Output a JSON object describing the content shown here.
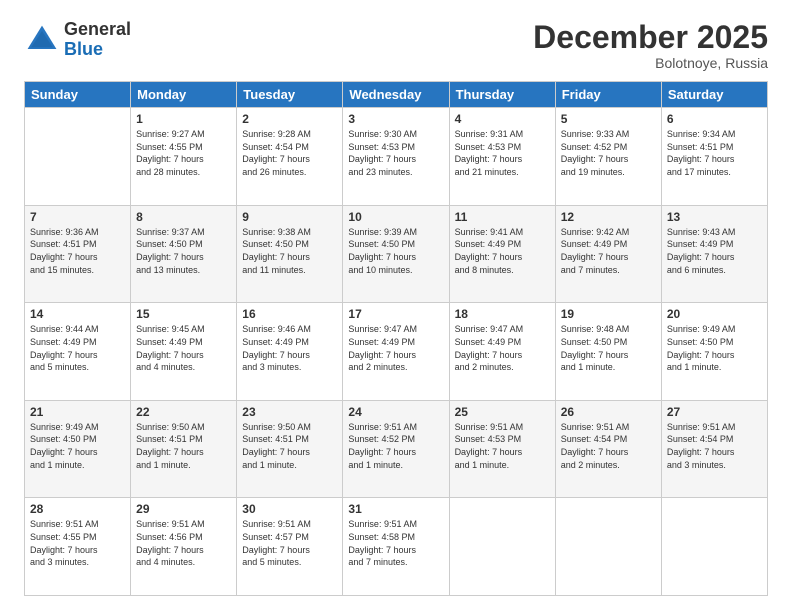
{
  "logo": {
    "general": "General",
    "blue": "Blue"
  },
  "header": {
    "month": "December 2025",
    "location": "Bolotnoye, Russia"
  },
  "days": [
    "Sunday",
    "Monday",
    "Tuesday",
    "Wednesday",
    "Thursday",
    "Friday",
    "Saturday"
  ],
  "weeks": [
    [
      {
        "day": "",
        "content": ""
      },
      {
        "day": "1",
        "content": "Sunrise: 9:27 AM\nSunset: 4:55 PM\nDaylight: 7 hours\nand 28 minutes."
      },
      {
        "day": "2",
        "content": "Sunrise: 9:28 AM\nSunset: 4:54 PM\nDaylight: 7 hours\nand 26 minutes."
      },
      {
        "day": "3",
        "content": "Sunrise: 9:30 AM\nSunset: 4:53 PM\nDaylight: 7 hours\nand 23 minutes."
      },
      {
        "day": "4",
        "content": "Sunrise: 9:31 AM\nSunset: 4:53 PM\nDaylight: 7 hours\nand 21 minutes."
      },
      {
        "day": "5",
        "content": "Sunrise: 9:33 AM\nSunset: 4:52 PM\nDaylight: 7 hours\nand 19 minutes."
      },
      {
        "day": "6",
        "content": "Sunrise: 9:34 AM\nSunset: 4:51 PM\nDaylight: 7 hours\nand 17 minutes."
      }
    ],
    [
      {
        "day": "7",
        "content": "Sunrise: 9:36 AM\nSunset: 4:51 PM\nDaylight: 7 hours\nand 15 minutes."
      },
      {
        "day": "8",
        "content": "Sunrise: 9:37 AM\nSunset: 4:50 PM\nDaylight: 7 hours\nand 13 minutes."
      },
      {
        "day": "9",
        "content": "Sunrise: 9:38 AM\nSunset: 4:50 PM\nDaylight: 7 hours\nand 11 minutes."
      },
      {
        "day": "10",
        "content": "Sunrise: 9:39 AM\nSunset: 4:50 PM\nDaylight: 7 hours\nand 10 minutes."
      },
      {
        "day": "11",
        "content": "Sunrise: 9:41 AM\nSunset: 4:49 PM\nDaylight: 7 hours\nand 8 minutes."
      },
      {
        "day": "12",
        "content": "Sunrise: 9:42 AM\nSunset: 4:49 PM\nDaylight: 7 hours\nand 7 minutes."
      },
      {
        "day": "13",
        "content": "Sunrise: 9:43 AM\nSunset: 4:49 PM\nDaylight: 7 hours\nand 6 minutes."
      }
    ],
    [
      {
        "day": "14",
        "content": "Sunrise: 9:44 AM\nSunset: 4:49 PM\nDaylight: 7 hours\nand 5 minutes."
      },
      {
        "day": "15",
        "content": "Sunrise: 9:45 AM\nSunset: 4:49 PM\nDaylight: 7 hours\nand 4 minutes."
      },
      {
        "day": "16",
        "content": "Sunrise: 9:46 AM\nSunset: 4:49 PM\nDaylight: 7 hours\nand 3 minutes."
      },
      {
        "day": "17",
        "content": "Sunrise: 9:47 AM\nSunset: 4:49 PM\nDaylight: 7 hours\nand 2 minutes."
      },
      {
        "day": "18",
        "content": "Sunrise: 9:47 AM\nSunset: 4:49 PM\nDaylight: 7 hours\nand 2 minutes."
      },
      {
        "day": "19",
        "content": "Sunrise: 9:48 AM\nSunset: 4:50 PM\nDaylight: 7 hours\nand 1 minute."
      },
      {
        "day": "20",
        "content": "Sunrise: 9:49 AM\nSunset: 4:50 PM\nDaylight: 7 hours\nand 1 minute."
      }
    ],
    [
      {
        "day": "21",
        "content": "Sunrise: 9:49 AM\nSunset: 4:50 PM\nDaylight: 7 hours\nand 1 minute."
      },
      {
        "day": "22",
        "content": "Sunrise: 9:50 AM\nSunset: 4:51 PM\nDaylight: 7 hours\nand 1 minute."
      },
      {
        "day": "23",
        "content": "Sunrise: 9:50 AM\nSunset: 4:51 PM\nDaylight: 7 hours\nand 1 minute."
      },
      {
        "day": "24",
        "content": "Sunrise: 9:51 AM\nSunset: 4:52 PM\nDaylight: 7 hours\nand 1 minute."
      },
      {
        "day": "25",
        "content": "Sunrise: 9:51 AM\nSunset: 4:53 PM\nDaylight: 7 hours\nand 1 minute."
      },
      {
        "day": "26",
        "content": "Sunrise: 9:51 AM\nSunset: 4:54 PM\nDaylight: 7 hours\nand 2 minutes."
      },
      {
        "day": "27",
        "content": "Sunrise: 9:51 AM\nSunset: 4:54 PM\nDaylight: 7 hours\nand 3 minutes."
      }
    ],
    [
      {
        "day": "28",
        "content": "Sunrise: 9:51 AM\nSunset: 4:55 PM\nDaylight: 7 hours\nand 3 minutes."
      },
      {
        "day": "29",
        "content": "Sunrise: 9:51 AM\nSunset: 4:56 PM\nDaylight: 7 hours\nand 4 minutes."
      },
      {
        "day": "30",
        "content": "Sunrise: 9:51 AM\nSunset: 4:57 PM\nDaylight: 7 hours\nand 5 minutes."
      },
      {
        "day": "31",
        "content": "Sunrise: 9:51 AM\nSunset: 4:58 PM\nDaylight: 7 hours\nand 7 minutes."
      },
      {
        "day": "",
        "content": ""
      },
      {
        "day": "",
        "content": ""
      },
      {
        "day": "",
        "content": ""
      }
    ]
  ]
}
